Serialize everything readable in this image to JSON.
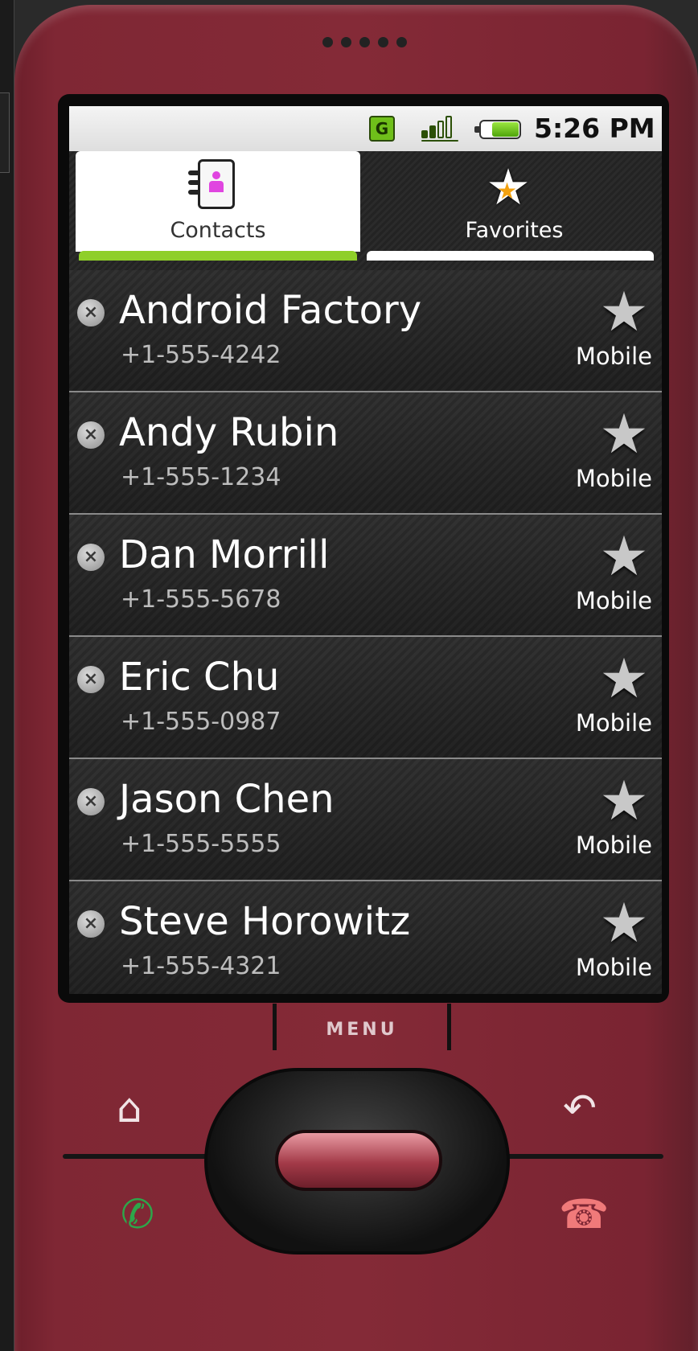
{
  "status_bar": {
    "network_badge": "G",
    "time": "5:26 PM",
    "icons": [
      "edge-network-icon",
      "signal-strength-icon",
      "battery-icon"
    ]
  },
  "tabs": [
    {
      "label": "Contacts",
      "icon": "contact-book-icon",
      "selected": true
    },
    {
      "label": "Favorites",
      "icon": "star-icon",
      "selected": false
    }
  ],
  "contacts": [
    {
      "name": "Android Factory",
      "phone": "+1-555-4242",
      "type": "Mobile"
    },
    {
      "name": "Andy Rubin",
      "phone": "+1-555-1234",
      "type": "Mobile"
    },
    {
      "name": "Dan Morrill",
      "phone": "+1-555-5678",
      "type": "Mobile"
    },
    {
      "name": "Eric Chu",
      "phone": "+1-555-0987",
      "type": "Mobile"
    },
    {
      "name": "Jason Chen",
      "phone": "+1-555-5555",
      "type": "Mobile"
    },
    {
      "name": "Steve Horowitz",
      "phone": "+1-555-4321",
      "type": "Mobile"
    }
  ],
  "hardware": {
    "menu_label": "MENU",
    "buttons": [
      "home-icon",
      "back-icon",
      "call-icon",
      "end-call-icon"
    ]
  },
  "colors": {
    "device_body": "#842a37",
    "tab_selected_underline": "#8fcf2a",
    "network_badge": "#6fbf1a",
    "favorite_star_accent": "#f3a10e",
    "call_button": "#2da64a",
    "end_call_button": "#f07a7a"
  }
}
